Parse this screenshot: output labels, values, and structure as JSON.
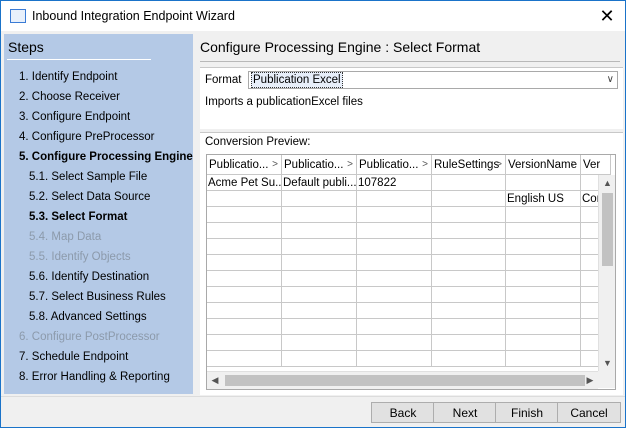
{
  "window": {
    "title": "Inbound Integration Endpoint Wizard",
    "close_glyph": "✕"
  },
  "sidebar": {
    "header": "Steps",
    "steps": [
      {
        "label": "1. Identify Endpoint",
        "state": "normal"
      },
      {
        "label": "2. Choose Receiver",
        "state": "normal"
      },
      {
        "label": "3. Configure Endpoint",
        "state": "normal"
      },
      {
        "label": "4. Configure PreProcessor",
        "state": "normal"
      },
      {
        "label": "5. Configure Processing Engine",
        "state": "bold"
      },
      {
        "label": "5.1. Select Sample File",
        "state": "normal"
      },
      {
        "label": "5.2. Select Data Source",
        "state": "normal"
      },
      {
        "label": "5.3. Select Format",
        "state": "bold"
      },
      {
        "label": "5.4. Map Data",
        "state": "disabled"
      },
      {
        "label": "5.5. Identify Objects",
        "state": "disabled"
      },
      {
        "label": "5.6. Identify Destination",
        "state": "normal"
      },
      {
        "label": "5.7. Select Business Rules",
        "state": "normal"
      },
      {
        "label": "5.8. Advanced Settings",
        "state": "normal"
      },
      {
        "label": "6. Configure PostProcessor",
        "state": "disabled"
      },
      {
        "label": "7. Schedule Endpoint",
        "state": "normal"
      },
      {
        "label": "8. Error Handling & Reporting",
        "state": "normal"
      }
    ]
  },
  "main": {
    "title": "Configure Processing Engine : Select Format",
    "format": {
      "label": "Format",
      "selected": "Publication Excel",
      "description": "Imports a publicationExcel files"
    },
    "preview": {
      "label": "Conversion Preview:",
      "columns": [
        "Publicatio...",
        "Publicatio...",
        "Publicatio...",
        "RuleSettings",
        "VersionName",
        "Ver"
      ],
      "rows": [
        [
          "Acme Pet Su...",
          "Default publi...",
          "107822",
          "",
          "",
          ""
        ],
        [
          "",
          "",
          "",
          "",
          "English US",
          "Cor"
        ],
        [
          "",
          "",
          "",
          "",
          "",
          ""
        ],
        [
          "",
          "",
          "",
          "",
          "",
          ""
        ],
        [
          "",
          "",
          "",
          "",
          "",
          ""
        ],
        [
          "",
          "",
          "",
          "",
          "",
          ""
        ],
        [
          "",
          "",
          "",
          "",
          "",
          ""
        ],
        [
          "",
          "",
          "",
          "",
          "",
          ""
        ],
        [
          "",
          "",
          "",
          "",
          "",
          ""
        ],
        [
          "",
          "",
          "",
          "",
          "",
          ""
        ],
        [
          "",
          "",
          "",
          "",
          "",
          ""
        ],
        [
          "",
          "",
          "",
          "",
          "",
          ""
        ]
      ]
    }
  },
  "buttons": {
    "back": "Back",
    "next": "Next",
    "finish": "Finish",
    "cancel": "Cancel"
  }
}
